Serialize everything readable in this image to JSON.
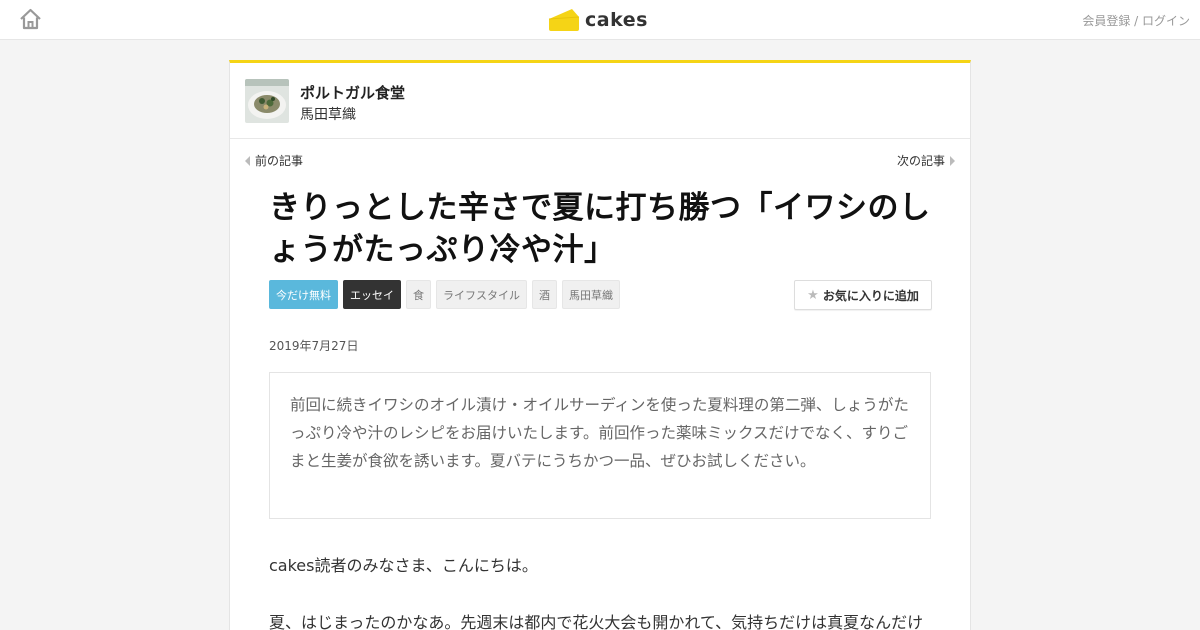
{
  "header": {
    "logo_text": "cakes",
    "login_label": "会員登録 / ログイン"
  },
  "series": {
    "title": "ポルトガル食堂",
    "author": "馬田草織"
  },
  "nav": {
    "prev_label": "前の記事",
    "next_label": "次の記事"
  },
  "article": {
    "title": "きりっとした辛さで夏に打ち勝つ「イワシのしょうがたっぷり冷や汁」",
    "tags": [
      {
        "label": "今だけ無料",
        "style": "free"
      },
      {
        "label": "エッセイ",
        "style": "essay"
      },
      {
        "label": "食",
        "style": "plain"
      },
      {
        "label": "ライフスタイル",
        "style": "plain"
      },
      {
        "label": "酒",
        "style": "plain"
      },
      {
        "label": "馬田草織",
        "style": "plain"
      }
    ],
    "favorite_label": "お気に入りに追加",
    "date": "2019年7月27日",
    "lead": "前回に続きイワシのオイル漬け・オイルサーディンを使った夏料理の第二弾、しょうがたっぷり冷や汁のレシピをお届けいたします。前回作った薬味ミックスだけでなく、すりごまと生姜が食欲を誘います。夏バテにうちかつ一品、ぜひお試しください。",
    "body_p1": "cakes読者のみなさま、こんにちは。",
    "body_p2": "夏、はじまったのかなあ。先週末は都内で花火大会も開かれて、気持ちだけは真夏なんだけ"
  },
  "colors": {
    "accent_yellow": "#f5d416",
    "free_tag": "#5ab8dc",
    "essay_tag": "#333333"
  },
  "icons": {
    "home": "home-icon",
    "logo": "cheese-logo-icon",
    "star": "star-icon"
  }
}
